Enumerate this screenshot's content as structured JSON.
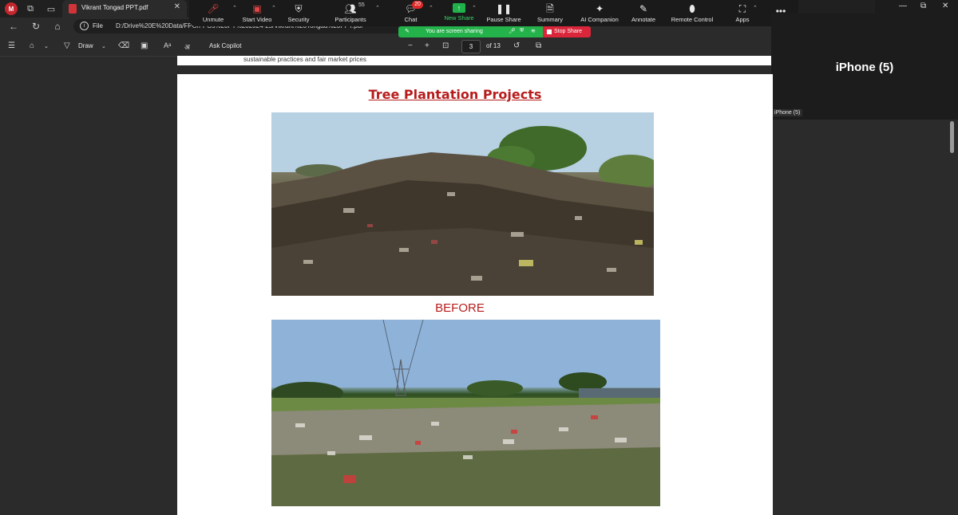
{
  "browser": {
    "tab_title": "Vikrant Tongad PPT.pdf",
    "address_scheme": "File",
    "address_url": "D:/Drive%20E%20Data/FPO/FPOs%20FY%202024-25/Vikrant%20Tongad%20PPT.pdf"
  },
  "pdf_toolbar": {
    "draw_label": "Draw",
    "copilot_label": "Ask Copilot",
    "page_current": "3",
    "page_total": "of 13"
  },
  "meeting_toolbar": {
    "items": [
      {
        "label": "Unmute",
        "icon": "mic-muted-icon"
      },
      {
        "label": "Start Video",
        "icon": "video-off-icon"
      },
      {
        "label": "Security",
        "icon": "shield-icon"
      },
      {
        "label": "Participants",
        "icon": "participants-icon",
        "count": "55"
      },
      {
        "label": "Chat",
        "icon": "chat-icon",
        "badge": "20"
      },
      {
        "label": "New Share",
        "icon": "share-icon"
      },
      {
        "label": "Pause Share",
        "icon": "pause-icon"
      },
      {
        "label": "Summary",
        "icon": "summary-icon"
      },
      {
        "label": "AI Companion",
        "icon": "sparkle-icon"
      },
      {
        "label": "Annotate",
        "icon": "pen-icon"
      },
      {
        "label": "Remote Control",
        "icon": "mouse-icon"
      },
      {
        "label": "Apps",
        "icon": "apps-icon"
      }
    ]
  },
  "share_banner": {
    "sharing_text": "You are screen sharing",
    "stop_label": "Stop Share",
    "accent_green": "#24b24a",
    "accent_red": "#d9263a"
  },
  "video_panel": {
    "participant_name": "iPhone (5)",
    "name_tag": "iPhone (5)"
  },
  "document": {
    "prev_page_cut_text": "sustainable practices and fair market prices",
    "title": "Tree Plantation Projects",
    "before_label": "BEFORE",
    "title_color": "#b71c1c"
  }
}
